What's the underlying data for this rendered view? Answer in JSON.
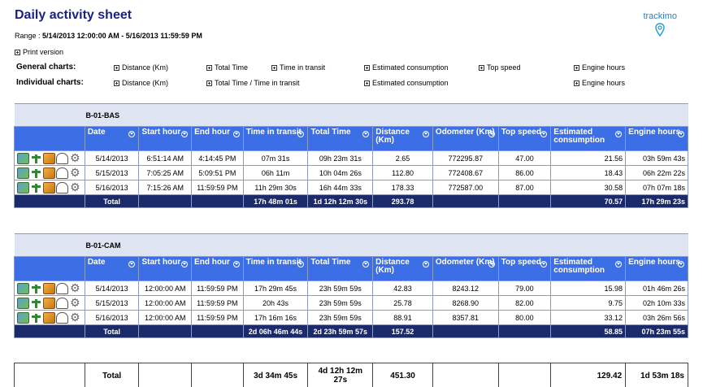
{
  "header": {
    "title": "Daily activity sheet",
    "range_label": "Range :",
    "range_value": "5/14/2013 12:00:00 AM - 5/16/2013 11:59:59 PM",
    "print_version": "Print version",
    "logo_text": "trackimo"
  },
  "charts": {
    "general_label": "General charts:",
    "individual_label": "Individual charts:",
    "general": [
      "Distance (Km)",
      "Total Time",
      "Time in transit",
      "Estimated consumption",
      "Top speed",
      "Engine hours"
    ],
    "individual": [
      "Distance (Km)",
      "Total Time / Time in transit",
      "Estimated consumption",
      "Engine hours"
    ]
  },
  "columns": [
    "Date",
    "Start hour",
    "End hour",
    "Time in transit",
    "Total Time",
    "Distance (Km)",
    "Odometer (Km)",
    "Top speed",
    "Estimated consumption",
    "Engine hours"
  ],
  "vehicles": [
    {
      "name": "B-01-BAS",
      "rows": [
        {
          "date": "5/14/2013",
          "start": "6:51:14 AM",
          "end": "4:14:45 PM",
          "transit": "07m 31s",
          "total": "09h 23m 31s",
          "distance": "2.65",
          "odometer": "772295.87",
          "speed": "47.00",
          "consumption": "21.56",
          "engine": "03h 59m 43s"
        },
        {
          "date": "5/15/2013",
          "start": "7:05:25 AM",
          "end": "5:09:51 PM",
          "transit": "06h 11m",
          "total": "10h 04m 26s",
          "distance": "112.80",
          "odometer": "772408.67",
          "speed": "86.00",
          "consumption": "18.43",
          "engine": "06h 22m 22s"
        },
        {
          "date": "5/16/2013",
          "start": "7:15:26 AM",
          "end": "11:59:59 PM",
          "transit": "11h 29m 30s",
          "total": "16h 44m 33s",
          "distance": "178.33",
          "odometer": "772587.00",
          "speed": "87.00",
          "consumption": "30.58",
          "engine": "07h 07m 18s"
        }
      ],
      "total": {
        "label": "Total",
        "transit": "17h 48m 01s",
        "total": "1d 12h 12m 30s",
        "distance": "293.78",
        "consumption": "70.57",
        "engine": "17h 29m 23s"
      }
    },
    {
      "name": "B-01-CAM",
      "rows": [
        {
          "date": "5/14/2013",
          "start": "12:00:00 AM",
          "end": "11:59:59 PM",
          "transit": "17h 29m 45s",
          "total": "23h 59m 59s",
          "distance": "42.83",
          "odometer": "8243.12",
          "speed": "79.00",
          "consumption": "15.98",
          "engine": "01h 46m 26s"
        },
        {
          "date": "5/15/2013",
          "start": "12:00:00 AM",
          "end": "11:59:59 PM",
          "transit": "20h 43s",
          "total": "23h 59m 59s",
          "distance": "25.78",
          "odometer": "8268.90",
          "speed": "82.00",
          "consumption": "9.75",
          "engine": "02h 10m 33s"
        },
        {
          "date": "5/16/2013",
          "start": "12:00:00 AM",
          "end": "11:59:59 PM",
          "transit": "17h 16m 16s",
          "total": "23h 59m 59s",
          "distance": "88.91",
          "odometer": "8357.81",
          "speed": "80.00",
          "consumption": "33.12",
          "engine": "03h 26m 56s"
        }
      ],
      "total": {
        "label": "Total",
        "transit": "2d 06h 46m 44s",
        "total": "2d 23h 59m 57s",
        "distance": "157.52",
        "consumption": "58.85",
        "engine": "07h 23m 55s"
      }
    }
  ],
  "summary": {
    "label": "Total",
    "transit": "3d 34m 45s",
    "total": "4d 12h 12m 27s",
    "distance": "451.30",
    "consumption": "129.42",
    "engine": "1d 53m 18s"
  },
  "row_icons": [
    "map-icon",
    "route-icon",
    "chart-icon",
    "gauge-icon",
    "gear-icon"
  ]
}
